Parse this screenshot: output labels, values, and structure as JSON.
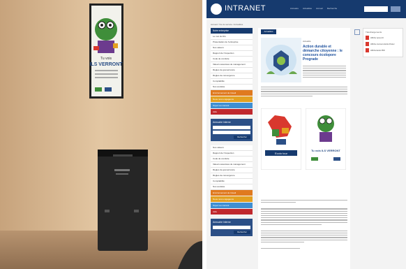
{
  "photo": {
    "poster_text_line1": "Tu vois",
    "poster_text_line2": "ILS VERRONT"
  },
  "website": {
    "logo_text": "INTRANET",
    "top_menu": [
      "Annuaire",
      "Actualités",
      "Accueil",
      "Recherche"
    ],
    "breadcrumb": "Accueil / Vie du service / Actualités",
    "content_button": "Actualités",
    "feature_category": "Actualité",
    "feature_title": "Action durable et démarche citoyenne : le concours écolopore Prograde",
    "sidebar": {
      "header": "Notre entreprise",
      "items": [
        "Le mot du DG",
        "Présentation de l'entreprise",
        "Nos valeurs",
        "Rapport de l'inspection",
        "Code de conduite",
        "Valeurs associées de management",
        "Règles de gouvernance",
        "Règles de convergence",
        "Comptabilité",
        "Nos sociétés"
      ],
      "colored": [
        {
          "label": "Environnement de travail",
          "color": "#e07a1f"
        },
        {
          "label": "Nous nous engageons",
          "color": "#e3a020"
        },
        {
          "label": "Soyez au courant",
          "color": "#3f8fd2"
        },
        {
          "label": "Aide",
          "color": "#c0282d"
        }
      ],
      "panel_title": "Annuaire interne",
      "panel_button": "Rechercher",
      "items2": [
        "Nos valeurs",
        "Rapport de l'inspection",
        "Code de conduite",
        "Valeurs associées de management",
        "Règles de gouvernance",
        "Règles de convergence",
        "Comptabilité",
        "Nos sociétés"
      ],
      "colored2": [
        {
          "label": "Environnement de travail",
          "color": "#e07a1f"
        },
        {
          "label": "Nous nous engageons",
          "color": "#e3a020"
        },
        {
          "label": "Soyez au courant",
          "color": "#3f8fd2"
        },
        {
          "label": "Aide",
          "color": "#c0282d"
        }
      ],
      "panel2_title": "Annuaire interne",
      "panel2_button": "Rechercher"
    },
    "right_title": "Téléchargements",
    "downloads": [
      "Affiche verso A3",
      "Affiche concours Ecolo Poster",
      "Affiche Ecolo PDF"
    ],
    "poster_a_caption": "Ecolo tour",
    "poster_b_caption": "Tu vois ILS VERRONT"
  }
}
